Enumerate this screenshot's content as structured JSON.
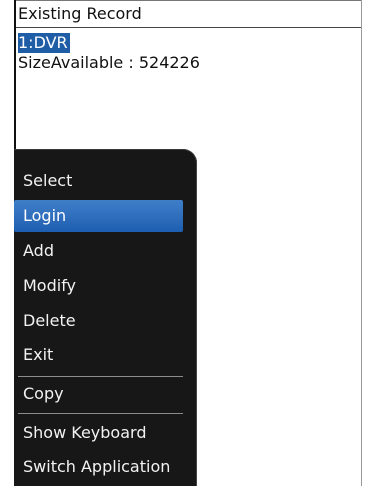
{
  "header": {
    "title": "Existing Record"
  },
  "records": {
    "selected_item": "1:DVR",
    "size_available": "SizeAvailable : 524226"
  },
  "menu": {
    "items": [
      {
        "label": "Select"
      },
      {
        "label": "Login"
      },
      {
        "label": "Add"
      },
      {
        "label": "Modify"
      },
      {
        "label": "Delete"
      },
      {
        "label": "Exit"
      },
      {
        "label": "Copy"
      },
      {
        "label": "Show Keyboard"
      },
      {
        "label": "Switch Application"
      }
    ],
    "highlighted": "Login"
  },
  "colors": {
    "selection": "#1f5da7",
    "menu_background": "#171717",
    "menu_highlight": "#2f6fbf"
  }
}
